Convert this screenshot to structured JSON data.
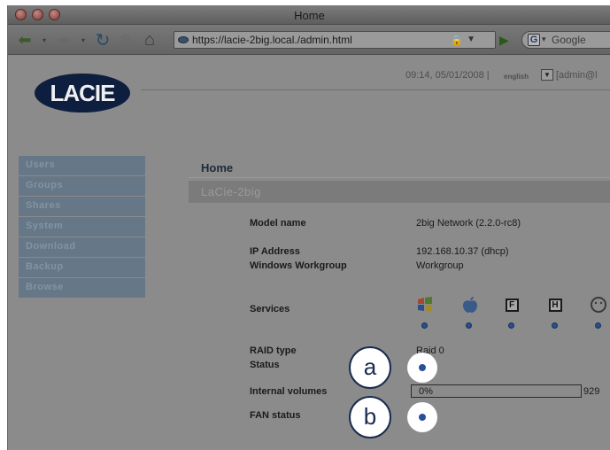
{
  "window": {
    "title": "Home"
  },
  "toolbar": {
    "url": "https://lacie-2big.local./admin.html",
    "search_placeholder": "Google",
    "search_engine_letter": "G"
  },
  "header": {
    "logo_text": "LACIE",
    "datetime": "09:14, 05/01/2008 |",
    "language": "english",
    "language_dropdown_glyph": "▼",
    "user_info": "[admin@l"
  },
  "sidebar": {
    "items": [
      {
        "label": "Users"
      },
      {
        "label": "Groups"
      },
      {
        "label": "Shares"
      },
      {
        "label": "System"
      },
      {
        "label": "Download"
      },
      {
        "label": "Backup"
      },
      {
        "label": "Browse"
      }
    ]
  },
  "content": {
    "title": "Home",
    "device_name": "LaCie-2big",
    "model_label": "Model name",
    "model_value": "2big Network (2.2.0-rc8)",
    "ip_label": "IP Address",
    "ip_value": "192.168.10.37 (dhcp)",
    "workgroup_label": "Windows Workgroup",
    "workgroup_value": "Workgroup",
    "services_label": "Services",
    "services": [
      {
        "icon": "windows-icon"
      },
      {
        "icon": "apple-icon"
      },
      {
        "icon": "ftp-icon",
        "letter": "F"
      },
      {
        "icon": "http-icon",
        "letter": "H"
      },
      {
        "icon": "bonjour-icon"
      }
    ],
    "raid_label": "RAID type",
    "raid_value": "Raid 0",
    "status_label": "Status",
    "volumes_label": "Internal volumes",
    "volume_percent": "0%",
    "volume_fraction": 0,
    "volume_size": "929",
    "fan_label": "FAN status"
  },
  "callouts": {
    "a": "a",
    "b": "b"
  },
  "colors": {
    "status_dot": "#2a4f9a",
    "callout_border": "#1a2c50",
    "logo_bg": "#0e1e3e"
  }
}
